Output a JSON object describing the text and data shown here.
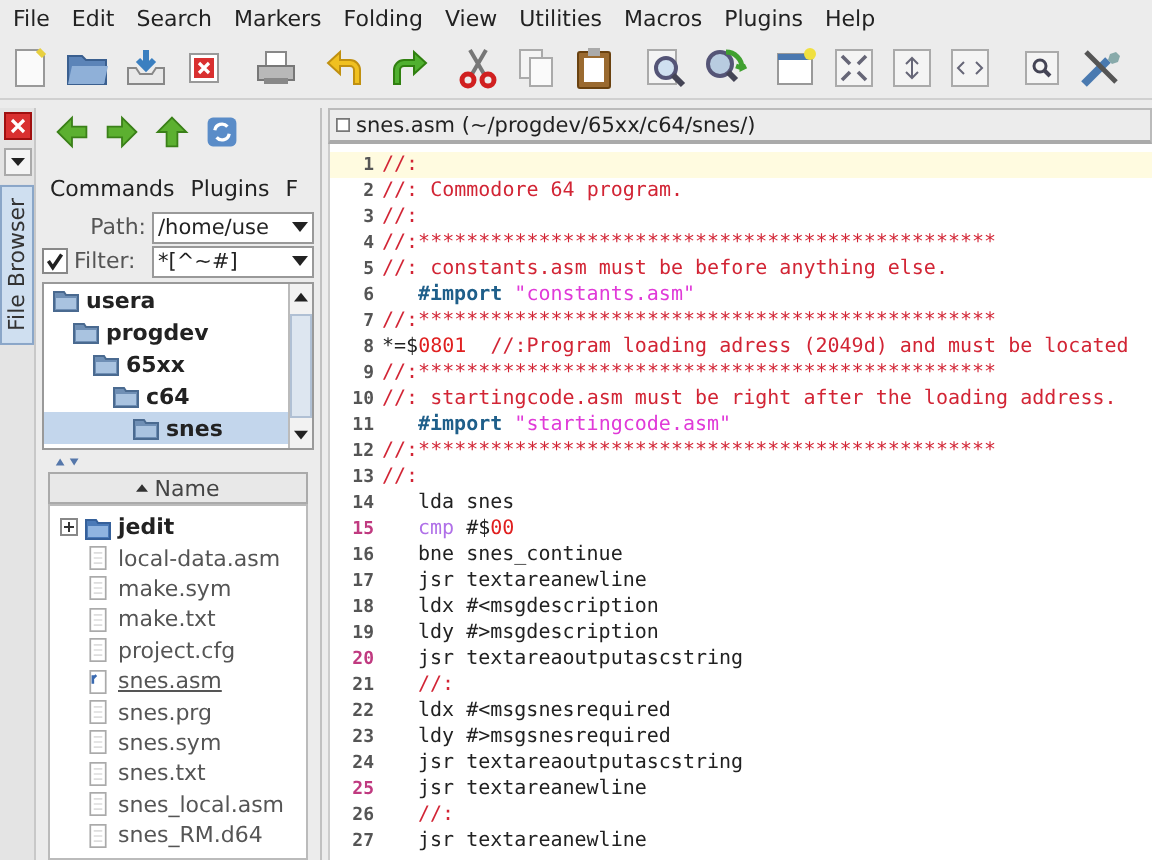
{
  "menu": [
    "File",
    "Edit",
    "Search",
    "Markers",
    "Folding",
    "View",
    "Utilities",
    "Macros",
    "Plugins",
    "Help"
  ],
  "dock": {
    "tab": "File Browser",
    "selected": true
  },
  "file_browser": {
    "menus": [
      "Commands",
      "Plugins",
      "F"
    ],
    "path_label": "Path:",
    "path_value": "/home/use",
    "filter_label": "Filter:",
    "filter_checked": true,
    "filter_value": "*[^~#]",
    "tree": [
      {
        "name": "usera",
        "selected": false,
        "children": [
          {
            "name": "progdev",
            "selected": false,
            "children": [
              {
                "name": "65xx",
                "selected": false,
                "children": [
                  {
                    "name": "c64",
                    "selected": false,
                    "children": [
                      {
                        "name": "snes",
                        "selected": true
                      }
                    ]
                  }
                ]
              }
            ]
          }
        ]
      }
    ],
    "column": "Name",
    "files": [
      {
        "name": "jedit",
        "kind": "folder",
        "open": false
      },
      {
        "name": "local-data.asm",
        "kind": "file",
        "open": false
      },
      {
        "name": "make.sym",
        "kind": "file",
        "open": false
      },
      {
        "name": "make.txt",
        "kind": "file",
        "open": false
      },
      {
        "name": "project.cfg",
        "kind": "file",
        "open": false
      },
      {
        "name": "snes.asm",
        "kind": "file",
        "open": true
      },
      {
        "name": "snes.prg",
        "kind": "file",
        "open": false
      },
      {
        "name": "snes.sym",
        "kind": "file",
        "open": false
      },
      {
        "name": "snes.txt",
        "kind": "file",
        "open": false
      },
      {
        "name": "snes_local.asm",
        "kind": "file",
        "open": false
      },
      {
        "name": "snes_RM.d64",
        "kind": "file",
        "open": false
      }
    ]
  },
  "editor": {
    "title": "snes.asm (~/progdev/65xx/c64/snes/)",
    "lines": [
      {
        "number": "1",
        "current": true,
        "marked": false,
        "indent": false,
        "tokens": [
          {
            "t": "//:",
            "kind": "comment"
          }
        ]
      },
      {
        "number": "2",
        "current": false,
        "marked": false,
        "indent": false,
        "tokens": [
          {
            "t": "//: Commodore 64 program.",
            "kind": "comment"
          }
        ]
      },
      {
        "number": "3",
        "current": false,
        "marked": false,
        "indent": false,
        "tokens": [
          {
            "t": "//:",
            "kind": "comment"
          }
        ]
      },
      {
        "number": "4",
        "current": false,
        "marked": false,
        "indent": false,
        "tokens": [
          {
            "t": "//:************************************************",
            "kind": "comment"
          }
        ]
      },
      {
        "number": "5",
        "current": false,
        "marked": false,
        "indent": false,
        "tokens": [
          {
            "t": "//: constants.asm must be before anything else.",
            "kind": "comment"
          }
        ]
      },
      {
        "number": "6",
        "current": false,
        "marked": false,
        "indent": true,
        "tokens": [
          {
            "t": "#import",
            "kind": "directive"
          },
          {
            "t": "\"constants.asm\"",
            "kind": "string"
          }
        ]
      },
      {
        "number": "7",
        "current": false,
        "marked": false,
        "indent": false,
        "tokens": [
          {
            "t": "//:************************************************",
            "kind": "comment"
          }
        ]
      },
      {
        "number": "8",
        "current": false,
        "marked": false,
        "indent": false,
        "tokens": [
          {
            "t": "*=$",
            "kind": "plain"
          },
          {
            "t": "0801",
            "kind": "literal"
          },
          {
            "t": "//:Program loading adress (2049d) and must be located",
            "kind": "comment"
          }
        ]
      },
      {
        "number": "9",
        "current": false,
        "marked": false,
        "indent": false,
        "tokens": [
          {
            "t": "//:************************************************",
            "kind": "comment"
          }
        ]
      },
      {
        "number": "10",
        "current": false,
        "marked": false,
        "indent": false,
        "tokens": [
          {
            "t": "//: startingcode.asm must be right after the loading address.",
            "kind": "comment"
          }
        ]
      },
      {
        "number": "11",
        "current": false,
        "marked": false,
        "indent": true,
        "tokens": [
          {
            "t": "#import",
            "kind": "directive"
          },
          {
            "t": "\"startingcode.asm\"",
            "kind": "string"
          }
        ]
      },
      {
        "number": "12",
        "current": false,
        "marked": false,
        "indent": false,
        "tokens": [
          {
            "t": "//:************************************************",
            "kind": "comment"
          }
        ]
      },
      {
        "number": "13",
        "current": false,
        "marked": false,
        "indent": false,
        "tokens": [
          {
            "t": "//:",
            "kind": "comment"
          }
        ]
      },
      {
        "number": "14",
        "current": false,
        "marked": false,
        "indent": true,
        "tokens": [
          {
            "t": "lda snes",
            "kind": "plain"
          }
        ]
      },
      {
        "number": "15",
        "current": false,
        "marked": true,
        "indent": true,
        "tokens": [
          {
            "t": "cmp",
            "kind": "keyword"
          },
          {
            "t": "#$",
            "kind": "plain"
          },
          {
            "t": "00",
            "kind": "literal"
          }
        ]
      },
      {
        "number": "16",
        "current": false,
        "marked": false,
        "indent": true,
        "tokens": [
          {
            "t": "bne snes_continue",
            "kind": "plain"
          }
        ]
      },
      {
        "number": "17",
        "current": false,
        "marked": false,
        "indent": true,
        "tokens": [
          {
            "t": "jsr textareanewline",
            "kind": "plain"
          }
        ]
      },
      {
        "number": "18",
        "current": false,
        "marked": false,
        "indent": true,
        "tokens": [
          {
            "t": "ldx #<msgdescription",
            "kind": "plain"
          }
        ]
      },
      {
        "number": "19",
        "current": false,
        "marked": false,
        "indent": true,
        "tokens": [
          {
            "t": "ldy #>msgdescription",
            "kind": "plain"
          }
        ]
      },
      {
        "number": "20",
        "current": false,
        "marked": true,
        "indent": true,
        "tokens": [
          {
            "t": "jsr textareaoutputascstring",
            "kind": "plain"
          }
        ]
      },
      {
        "number": "21",
        "current": false,
        "marked": false,
        "indent": true,
        "tokens": [
          {
            "t": "//:",
            "kind": "comment"
          }
        ]
      },
      {
        "number": "22",
        "current": false,
        "marked": false,
        "indent": true,
        "tokens": [
          {
            "t": "ldx #<msgsnesrequired",
            "kind": "plain"
          }
        ]
      },
      {
        "number": "23",
        "current": false,
        "marked": false,
        "indent": true,
        "tokens": [
          {
            "t": "ldy #>msgsnesrequired",
            "kind": "plain"
          }
        ]
      },
      {
        "number": "24",
        "current": false,
        "marked": false,
        "indent": true,
        "tokens": [
          {
            "t": "jsr textareaoutputascstring",
            "kind": "plain"
          }
        ]
      },
      {
        "number": "25",
        "current": false,
        "marked": true,
        "indent": true,
        "tokens": [
          {
            "t": "jsr textareanewline",
            "kind": "plain"
          }
        ]
      },
      {
        "number": "26",
        "current": false,
        "marked": false,
        "indent": true,
        "tokens": [
          {
            "t": "//:",
            "kind": "comment"
          }
        ]
      },
      {
        "number": "27",
        "current": false,
        "marked": false,
        "indent": true,
        "tokens": [
          {
            "t": "jsr textareanewline",
            "kind": "plain"
          }
        ]
      }
    ]
  }
}
